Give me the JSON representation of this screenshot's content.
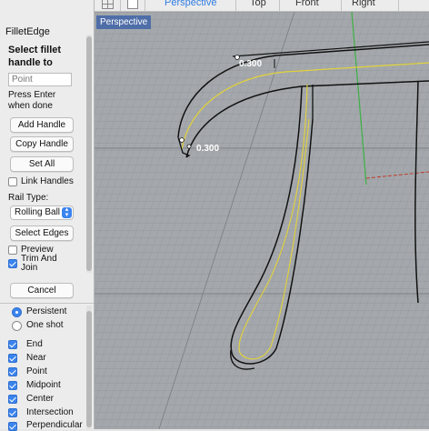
{
  "sidebar": {
    "title": "FilletEdge",
    "prompt": "Select fillet handle to",
    "point_placeholder": "Point",
    "hint": "Press Enter when done",
    "add_handle": "Add Handle",
    "copy_handle": "Copy Handle",
    "set_all": "Set All",
    "link_handles": "Link Handles",
    "rail_type_label": "Rail Type:",
    "rail_type_value": "Rolling Ball",
    "select_edges": "Select Edges",
    "preview": "Preview",
    "trim_and_join": "Trim And Join",
    "cancel": "Cancel",
    "snap_mode": {
      "persistent": "Persistent",
      "one_shot": "One shot"
    },
    "osnaps": [
      "End",
      "Near",
      "Point",
      "Midpoint",
      "Center",
      "Intersection",
      "Perpendicular"
    ]
  },
  "toolbar": {
    "tabs": [
      "Perspective",
      "Top",
      "Front",
      "Right"
    ],
    "active_tab": "Perspective"
  },
  "viewport": {
    "title": "Perspective",
    "handle_labels": [
      "0.300",
      "0.300"
    ]
  },
  "colors": {
    "accent": "#2f7de1",
    "viewport_bg": "#a4a8ac",
    "selected_edge": "#e3d23a",
    "title_bg": "#4f6ea8"
  }
}
